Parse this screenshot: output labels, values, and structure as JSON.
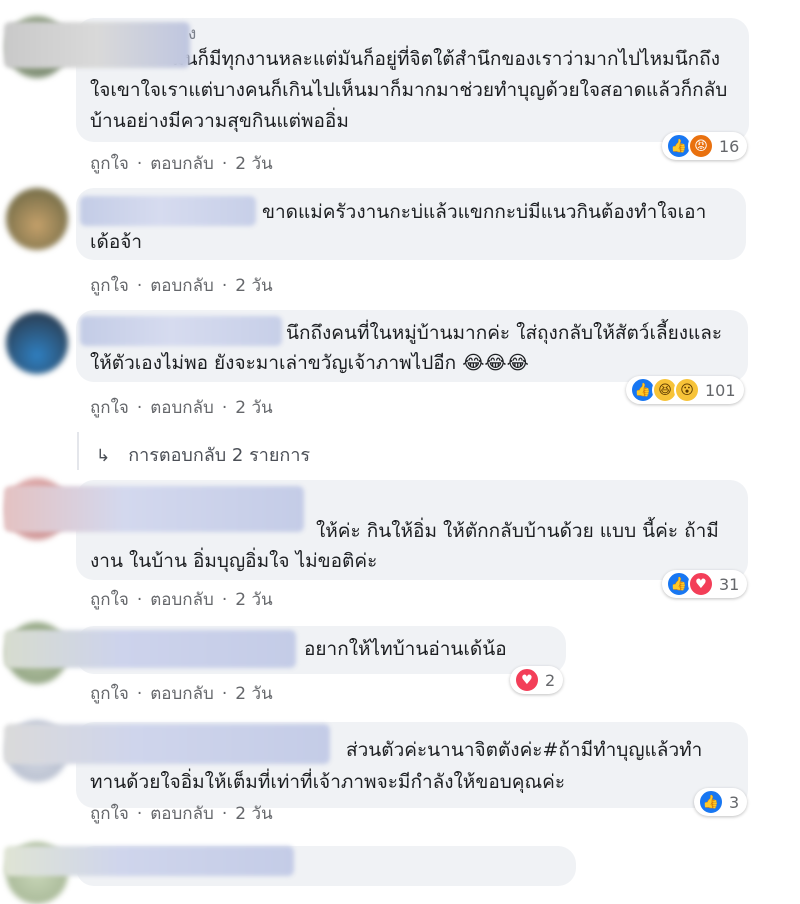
{
  "colors": {
    "bubble_bg": "#f0f2f5",
    "action_text": "#65676b",
    "like_blue": "#1877f2",
    "love_red": "#f33e58"
  },
  "actions": {
    "like": "ถูกใจ",
    "reply": "ตอบกลับ",
    "separator": "·",
    "time": "2 วัน"
  },
  "comments": [
    {
      "name_fragment": "ง",
      "text": "มันก็มีทุกงานหละแต่มันก็อยู่ที่จิตใต้สำนึกของเราว่ามากไปไหมนึกถึงใจเขาใจเราแต่บางคนก็เกินไปเห็นมาก็มากมาช่วยทำบุญด้วยใจสอาดแล้วก็กลับบ้านอย่างมีความสุขกินแต่พออิ่ม",
      "reactions": {
        "icons": [
          "like-icon",
          "angry-icon"
        ],
        "count": "16"
      }
    },
    {
      "text": "ขาดแม่ครัวงานกะบ่แล้วแขกกะบ่มีแนวกินต้องทำใจเอาเด้อจ้า",
      "reactions": null
    },
    {
      "text": "นึกถึงคนที่ในหมู่บ้านมากค่ะ ใส่ถุงกลับให้สัตว์เลี้ยงและให้ตัวเองไม่พอ ยังจะมาเล่าขวัญเจ้าภาพไปอีก 😂😂😂",
      "reactions": {
        "icons": [
          "like-icon",
          "haha-icon",
          "wow-icon"
        ],
        "count": "101"
      },
      "replies_label": "การตอบกลับ 2 รายการ"
    },
    {
      "text": "ให้ค่ะ กินให้อิ่ม ให้ตักกลับบ้านด้วย แบบ นี้ค่ะ ถ้ามีงาน ในบ้าน อิ่มบุญอิ่มใจ ไม่ขอติค่ะ",
      "reactions": {
        "icons": [
          "like-icon",
          "love-icon"
        ],
        "count": "31"
      }
    },
    {
      "text": "อยากให้ไทบ้านอ่านเด้น้อ",
      "reactions": {
        "icons": [
          "love-icon"
        ],
        "count": "2"
      }
    },
    {
      "text": "ส่วนตัวค่ะนานาจิตตังค่ะ#ถ้ามีทำบุญแล้วทำทานด้วยใจอิ่มให้เต็มที่เท่าที่เจ้าภาพจะมีกำลังให้ขอบคุณค่ะ",
      "reactions": {
        "icons": [
          "like-icon"
        ],
        "count": "3"
      }
    }
  ]
}
